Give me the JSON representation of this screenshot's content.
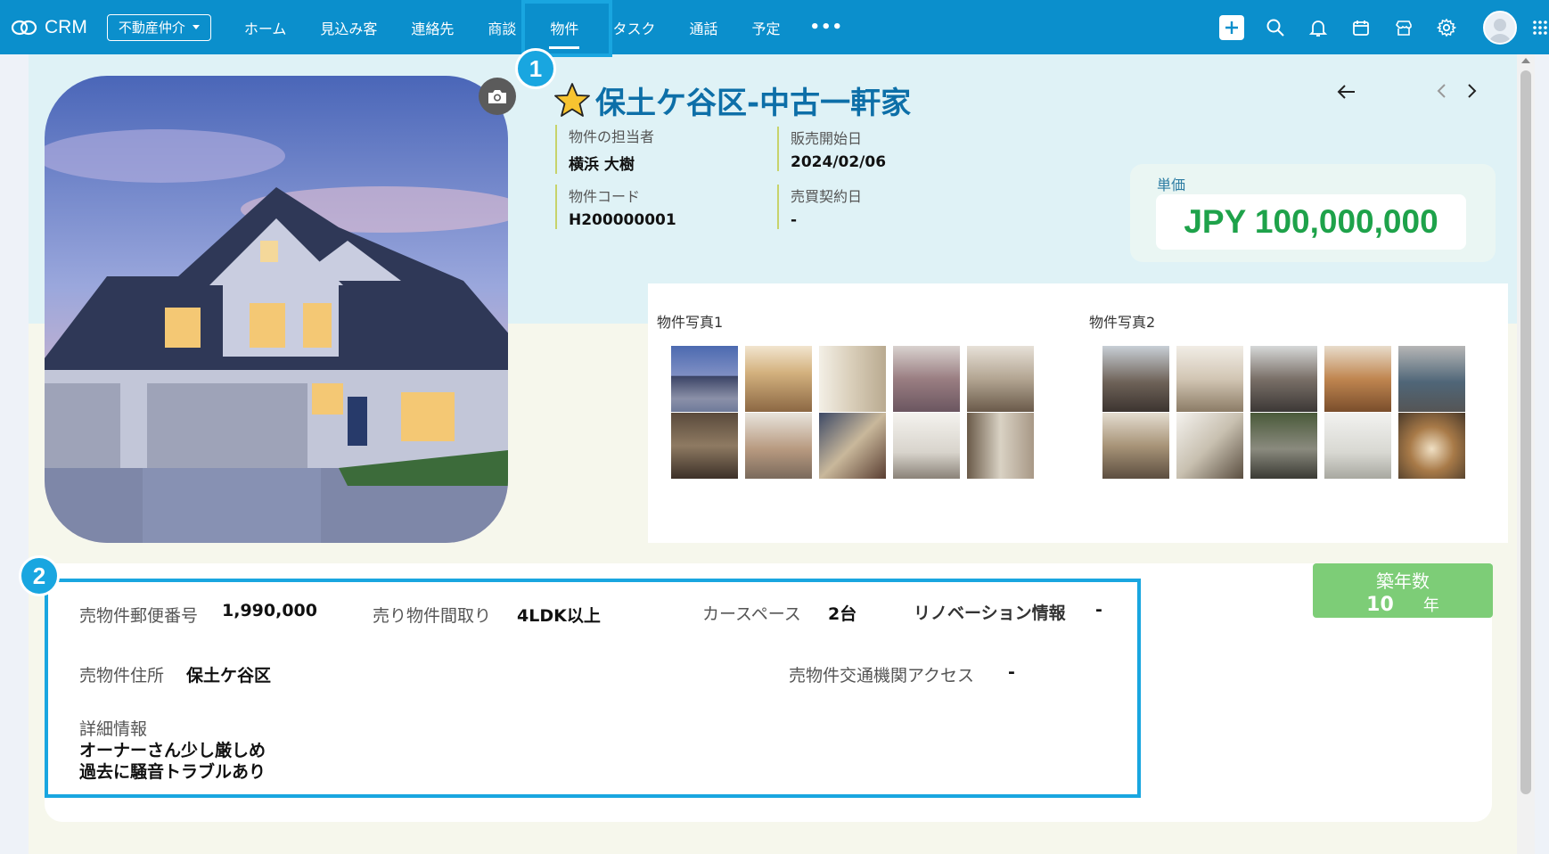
{
  "app": {
    "name": "CRM",
    "org": "不動産仲介"
  },
  "nav": {
    "items": [
      "ホーム",
      "見込み客",
      "連絡先",
      "商談",
      "物件",
      "タスク",
      "通話",
      "予定"
    ],
    "more": "•••",
    "active": "物件"
  },
  "icons": {
    "brand": "crm-logo-icon",
    "add": "plus-icon",
    "search": "search-icon",
    "notifications": "bell-icon",
    "calendar": "calendar-icon",
    "marketplace": "store-icon",
    "settings": "gear-icon",
    "apps": "grid-icon"
  },
  "annotations": {
    "one": "1",
    "two": "2"
  },
  "record": {
    "title": "保土ケ谷区-中古一軒家",
    "fields": [
      {
        "label": "物件の担当者",
        "value": "横浜 大樹"
      },
      {
        "label": "販売開始日",
        "value": "2024/02/06"
      },
      {
        "label": "物件コード",
        "value": "H200000001"
      },
      {
        "label": "売買契約日",
        "value": "-"
      }
    ],
    "price": {
      "label": "単価",
      "value": "JPY 100,000,000"
    }
  },
  "photos": {
    "group1": {
      "label": "物件写真1"
    },
    "group2": {
      "label": "物件写真2"
    }
  },
  "building_age": {
    "label": "築年数",
    "value": "10",
    "unit": "年"
  },
  "details": {
    "postal": {
      "label": "売物件郵便番号",
      "value": "1,990,000"
    },
    "layout": {
      "label": "売り物件間取り",
      "value": "4LDK以上"
    },
    "parking": {
      "label": "カースペース",
      "value": "2台"
    },
    "renovation": {
      "label": "リノベーション情報",
      "value": "-"
    },
    "address": {
      "label": "売物件住所",
      "value": "保土ケ谷区"
    },
    "access": {
      "label": "売物件交通機関アクセス",
      "value": "-"
    },
    "info": {
      "label": "詳細情報",
      "lines": [
        "オーナーさん少し厳しめ",
        "過去に騒音トラブルあり"
      ]
    }
  },
  "colors": {
    "nav_bg": "#0b8fcc",
    "accent": "#19a6e0",
    "price": "#1ea24a",
    "age_badge": "#7dcd77",
    "title": "#0d6fa8"
  }
}
